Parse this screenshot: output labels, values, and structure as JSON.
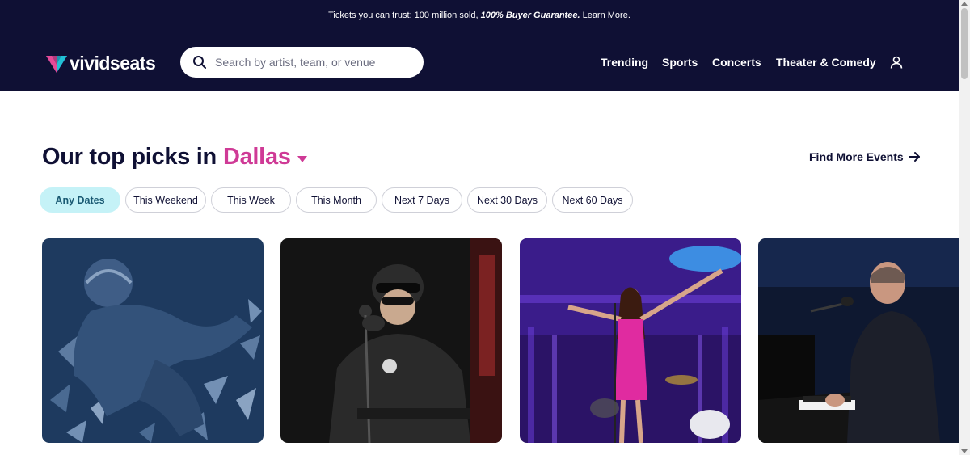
{
  "banner": {
    "text": "Tickets you can trust: 100 million sold, ",
    "guarantee": "100% Buyer Guarantee.",
    "learn_more": "Learn More."
  },
  "logo": {
    "text": "vividseats"
  },
  "search": {
    "placeholder": "Search by artist, team, or venue",
    "value": ""
  },
  "nav": {
    "items": [
      {
        "label": "Trending"
      },
      {
        "label": "Sports"
      },
      {
        "label": "Concerts"
      },
      {
        "label": "Theater & Comedy"
      }
    ]
  },
  "main": {
    "heading_prefix": "Our top picks in",
    "city": "Dallas",
    "find_more": "Find More Events",
    "filters": [
      {
        "label": "Any Dates",
        "active": true
      },
      {
        "label": "This Weekend",
        "active": false
      },
      {
        "label": "This Week",
        "active": false
      },
      {
        "label": "This Month",
        "active": false
      },
      {
        "label": "Next 7 Days",
        "active": false
      },
      {
        "label": "Next 30 Days",
        "active": false
      },
      {
        "label": "Next 60 Days",
        "active": false
      }
    ]
  },
  "colors": {
    "header_bg": "#0f1034",
    "accent_pink": "#cf3a96",
    "chip_active_bg": "#c5f2f7"
  },
  "icons": [
    "search-icon",
    "user-icon",
    "caret-down-icon",
    "arrow-right-icon"
  ]
}
